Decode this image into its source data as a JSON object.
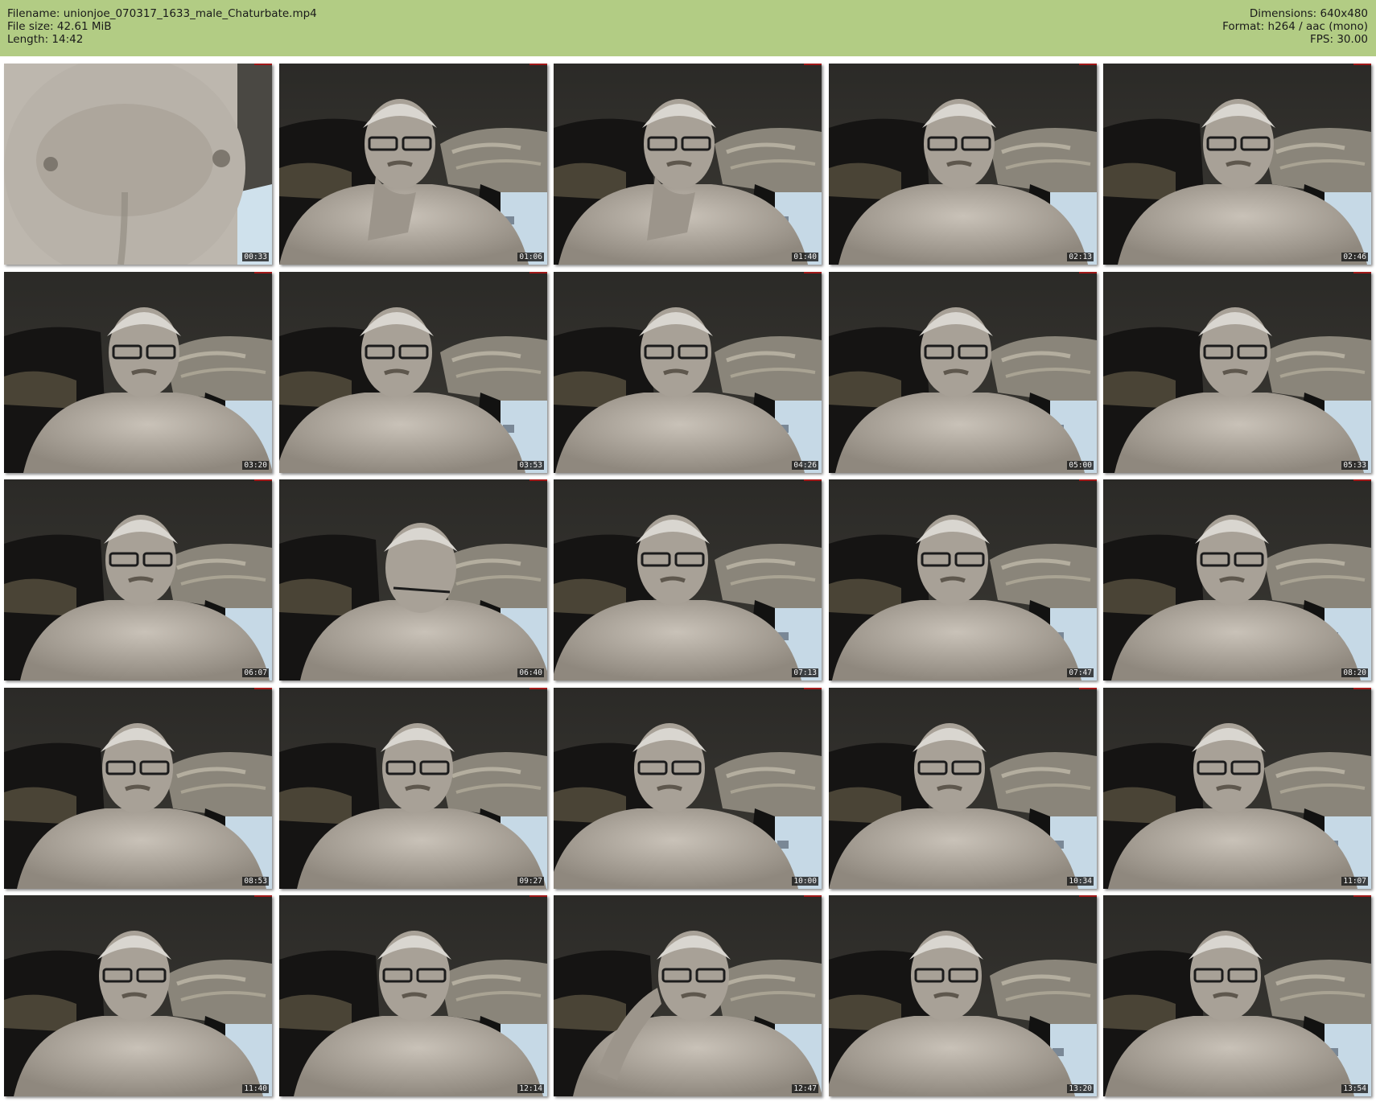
{
  "header": {
    "filename": "Filename: unionjoe_070317_1633_male_Chaturbate.mp4",
    "filesize": "File size: 42.61 MiB",
    "length": "Length: 14:42",
    "dimensions": "Dimensions: 640x480",
    "format": "Format: h264 / aac (mono)",
    "fps": "FPS: 30.00"
  },
  "colors": {
    "header_bg": "#b2cc84",
    "page_bg": "#ffffff"
  },
  "thumbnails": [
    {
      "time": "00:33",
      "scene": "chest-closeup"
    },
    {
      "time": "01:06",
      "scene": "hand-on-chin"
    },
    {
      "time": "01:40",
      "scene": "hand-on-chin"
    },
    {
      "time": "02:13",
      "scene": "face"
    },
    {
      "time": "02:46",
      "scene": "face"
    },
    {
      "time": "03:20",
      "scene": "face"
    },
    {
      "time": "03:53",
      "scene": "face"
    },
    {
      "time": "04:26",
      "scene": "face"
    },
    {
      "time": "05:00",
      "scene": "face"
    },
    {
      "time": "05:33",
      "scene": "face"
    },
    {
      "time": "06:07",
      "scene": "face"
    },
    {
      "time": "06:40",
      "scene": "looking-down"
    },
    {
      "time": "07:13",
      "scene": "face"
    },
    {
      "time": "07:47",
      "scene": "face"
    },
    {
      "time": "08:20",
      "scene": "face"
    },
    {
      "time": "08:53",
      "scene": "face"
    },
    {
      "time": "09:27",
      "scene": "face"
    },
    {
      "time": "10:00",
      "scene": "face"
    },
    {
      "time": "10:34",
      "scene": "face"
    },
    {
      "time": "11:07",
      "scene": "face"
    },
    {
      "time": "11:40",
      "scene": "face"
    },
    {
      "time": "12:14",
      "scene": "face"
    },
    {
      "time": "12:47",
      "scene": "hand-on-head"
    },
    {
      "time": "13:20",
      "scene": "face"
    },
    {
      "time": "13:54",
      "scene": "face"
    }
  ]
}
